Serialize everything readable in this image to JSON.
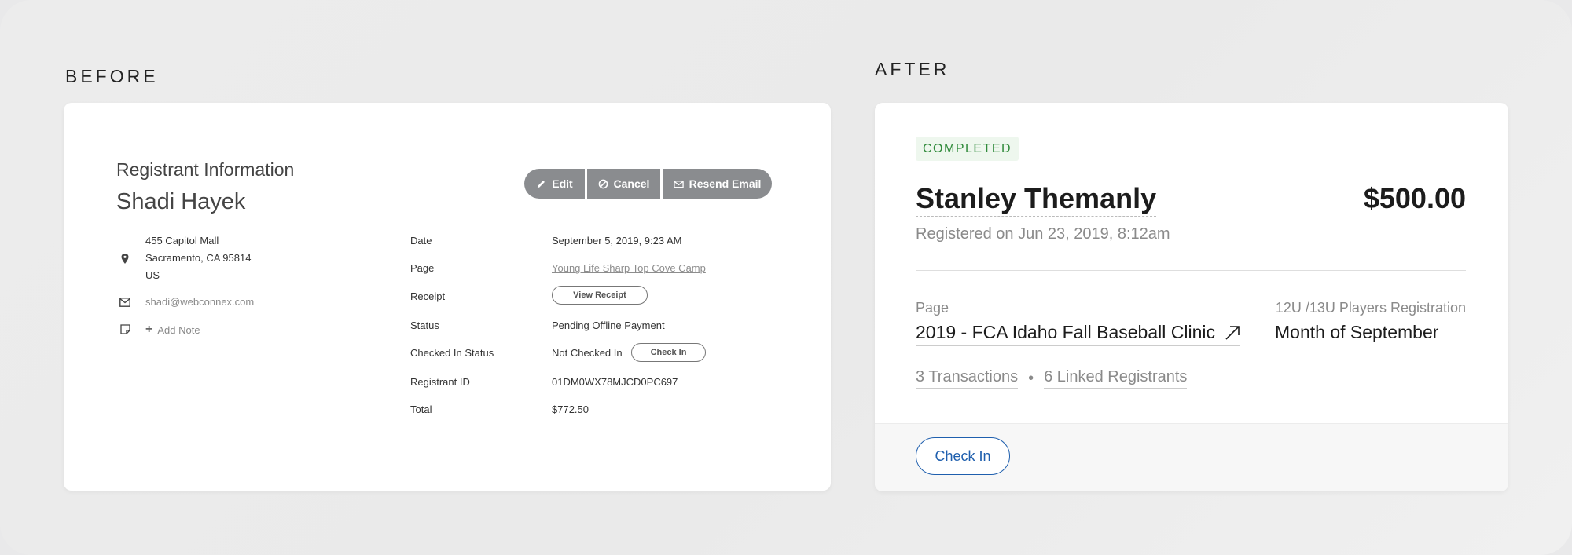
{
  "before": {
    "section_label": "BEFORE",
    "heading": "Registrant Information",
    "name": "Shadi Hayek",
    "buttons": {
      "edit": "Edit",
      "cancel": "Cancel",
      "resend_email": "Resend Email"
    },
    "address": [
      "455 Capitol Mall",
      "Sacramento, CA 95814",
      "US"
    ],
    "email": "shadi@webconnex.com",
    "add_note": "Add Note",
    "details": {
      "date_label": "Date",
      "date_value": "September 5, 2019, 9:23 AM",
      "page_label": "Page",
      "page_value": "Young Life Sharp Top Cove Camp",
      "receipt_label": "Receipt",
      "receipt_button": "View Receipt",
      "status_label": "Status",
      "status_value": "Pending Offline Payment",
      "checked_in_label": "Checked In Status",
      "checked_in_value": "Not Checked In",
      "check_in_button": "Check In",
      "registrant_id_label": "Registrant ID",
      "registrant_id_value": "01DM0WX78MJCD0PC697",
      "total_label": "Total",
      "total_value": "$772.50"
    }
  },
  "after": {
    "section_label": "AFTER",
    "status_badge": "COMPLETED",
    "name": "Stanley Themanly",
    "amount": "$500.00",
    "registered_on": "Registered on Jun 23, 2019, 8:12am",
    "page_label": "Page",
    "page_value": "2019 - FCA Idaho Fall Baseball Clinic",
    "right_label": "12U /13U Players Registration",
    "right_value": "Month of September",
    "transactions": "3 Transactions",
    "separator": "•",
    "linked_registrants": "6 Linked Registrants",
    "check_in_button": "Check In"
  },
  "colors": {
    "gray_button": "#8a8c8f",
    "completed_green": "#2f8a3a",
    "check_in_blue": "#1f5fae"
  }
}
